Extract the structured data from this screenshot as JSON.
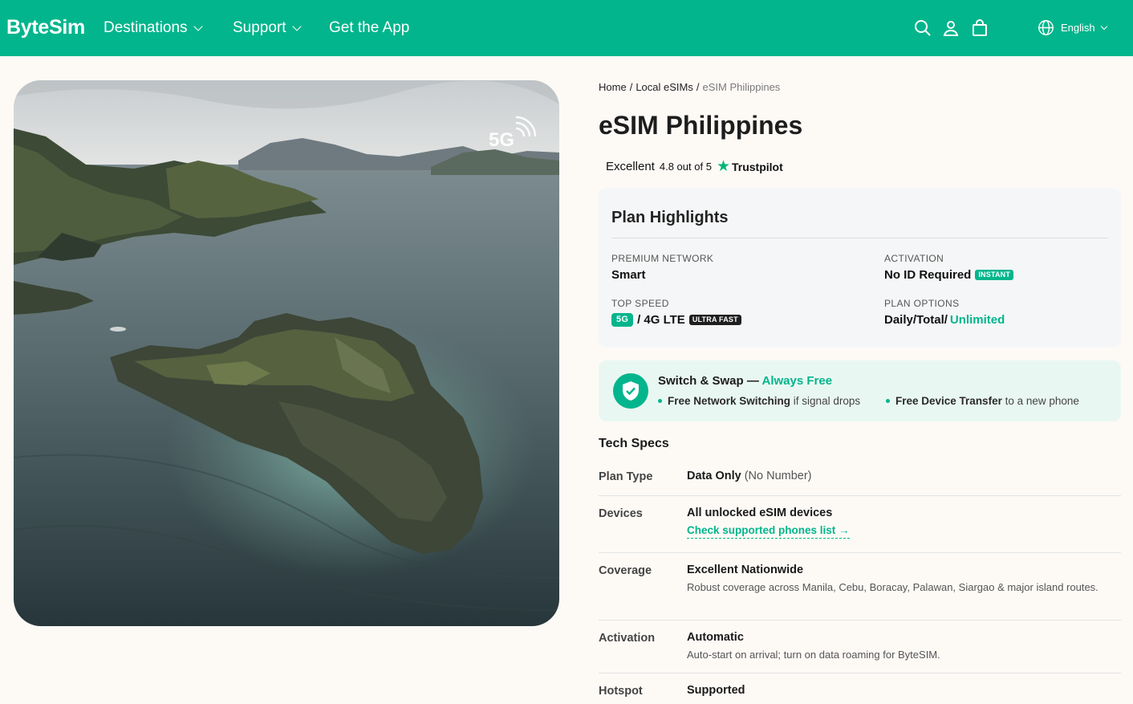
{
  "header": {
    "logo": "ByteSim",
    "nav": [
      "Destinations",
      "Support",
      "Get the App"
    ],
    "icons": [
      "search-icon",
      "account-icon",
      "cart-icon"
    ],
    "language": "English",
    "bg_color": "#02b58c"
  },
  "hero": {
    "badge": "5G"
  },
  "breadcrumb": {
    "home": "Home",
    "local": "Local eSIMs",
    "current": "eSIM Philippines",
    "separator": "/"
  },
  "product": {
    "title": "eSIM Philippines",
    "rating": {
      "label": "Excellent",
      "score_text": "4.8 out of 5",
      "provider": "Trustpilot"
    }
  },
  "highlights": {
    "title": "Plan Highlights",
    "network": {
      "label": "PREMIUM NETWORK",
      "value": "Smart"
    },
    "activation": {
      "label": "ACTIVATION",
      "value": "No ID Required",
      "badge": "INSTANT"
    },
    "speed": {
      "label": "TOP SPEED",
      "badge_5g": "5G",
      "value": "/ 4G LTE",
      "badge": "ULTRA FAST"
    },
    "plans": {
      "label": "PLAN OPTIONS",
      "value": "Daily/Total/",
      "accent": "Unlimited"
    }
  },
  "swap": {
    "title": "Switch & Swap —",
    "accent": "Always Free",
    "item1_bold": "Free Network Switching",
    "item1_rest": "if signal drops",
    "item2_bold": "Free Device Transfer",
    "item2_rest": "to a new phone"
  },
  "specs": {
    "title": "Tech Specs",
    "plan_type": {
      "key": "Plan Type",
      "value": "Data Only",
      "note": "(No Number)"
    },
    "devices": {
      "key": "Devices",
      "value": "All unlocked eSIM devices",
      "link": "Check supported phones list →"
    },
    "coverage": {
      "key": "Coverage",
      "value": "Excellent Nationwide",
      "sub": "Robust coverage across Manila, Cebu, Boracay, Palawan, Siargao & major island routes."
    },
    "activation": {
      "key": "Activation",
      "value": "Automatic",
      "sub": "Auto-start on arrival; turn on data roaming for ByteSIM."
    },
    "hotspot": {
      "key": "Hotspot",
      "value": "Supported"
    }
  }
}
